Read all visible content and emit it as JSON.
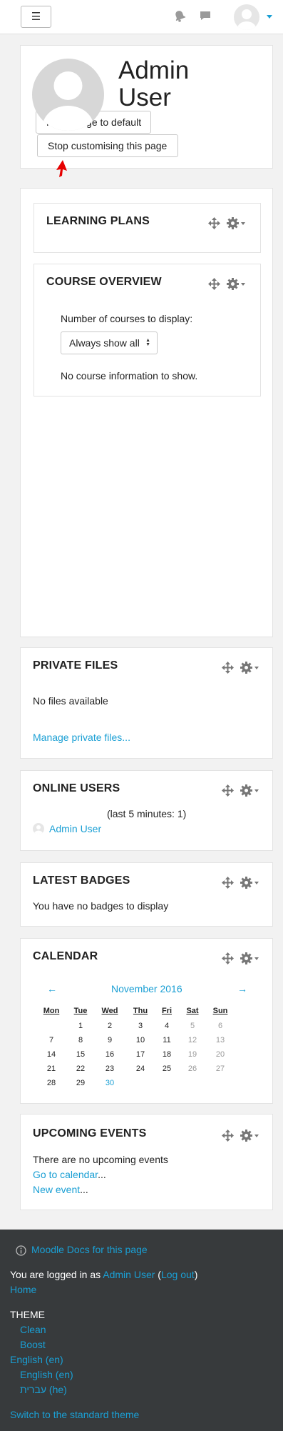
{
  "navbar": {
    "menu_glyph": "☰",
    "icons": [
      "bell-icon",
      "chat-icon",
      "user-avatar",
      "caret-down-icon"
    ]
  },
  "header": {
    "title_line1": "Admin",
    "title_line2": "User",
    "reset_button": "Reset page to default",
    "stop_button": "Stop customising this page"
  },
  "blocks": {
    "learning_plans": {
      "title": "LEARNING PLANS"
    },
    "course_overview": {
      "title": "COURSE OVERVIEW",
      "label": "Number of courses to display:",
      "select_value": "Always show all",
      "empty": "No course information to show."
    },
    "private_files": {
      "title": "PRIVATE FILES",
      "empty": "No files available",
      "manage_link": "Manage private files..."
    },
    "online_users": {
      "title": "ONLINE USERS",
      "subtitle": "(last 5 minutes: 1)",
      "user": "Admin User"
    },
    "latest_badges": {
      "title": "LATEST BADGES",
      "empty": "You have no badges to display"
    },
    "calendar": {
      "title": "CALENDAR",
      "prev": "←",
      "month": "November 2016",
      "next": "→",
      "weekdays": [
        "Mon",
        "Tue",
        "Wed",
        "Thu",
        "Fri",
        "Sat",
        "Sun"
      ],
      "weeks": [
        [
          "",
          "1",
          "2",
          "3",
          "4",
          "5",
          "6"
        ],
        [
          "7",
          "8",
          "9",
          "10",
          "11",
          "12",
          "13"
        ],
        [
          "14",
          "15",
          "16",
          "17",
          "18",
          "19",
          "20"
        ],
        [
          "21",
          "22",
          "23",
          "24",
          "25",
          "26",
          "27"
        ],
        [
          "28",
          "29",
          "30",
          "",
          "",
          "",
          ""
        ]
      ],
      "today": "30"
    },
    "upcoming_events": {
      "title": "UPCOMING EVENTS",
      "empty": "There are no upcoming events",
      "goto_link": "Go to calendar",
      "goto_suffix": "...",
      "new_link": "New event",
      "new_suffix": "..."
    }
  },
  "footer": {
    "docs_link": "Moodle Docs for this page",
    "logged_prefix": "You are logged in as ",
    "user_link": "Admin User",
    "paren_open": " (",
    "logout_link": "Log out",
    "paren_close": ")",
    "home_link": "Home",
    "theme_label": "THEME",
    "theme_clean": "Clean",
    "theme_boost": "Boost",
    "lang_current": "English (en)",
    "lang_en": "English (en)",
    "lang_he": "עברית (he)",
    "standard_theme_link": "Switch to the standard theme"
  }
}
